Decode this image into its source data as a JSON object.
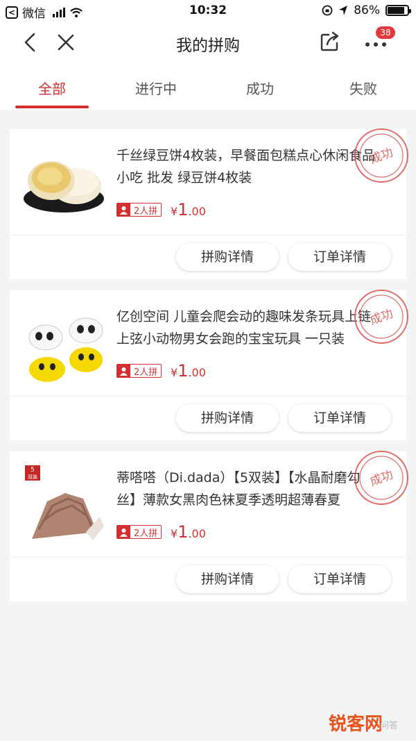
{
  "status_bar": {
    "carrier": "微信",
    "time": "10:32",
    "battery": "86%"
  },
  "nav": {
    "title": "我的拼购",
    "badge": "38"
  },
  "tabs": [
    {
      "label": "全部",
      "active": true
    },
    {
      "label": "进行中",
      "active": false
    },
    {
      "label": "成功",
      "active": false
    },
    {
      "label": "失败",
      "active": false
    }
  ],
  "orders": [
    {
      "title": "千丝绿豆饼4枚装，早餐面包糕点心休闲食品小吃 批发 绿豆饼4枚装",
      "group_tag": "2人拼",
      "price_symbol": "¥",
      "price_int": "1",
      "price_dec": ".00",
      "stamp": "成功",
      "btn_group": "拼购详情",
      "btn_order": "订单详情"
    },
    {
      "title": "亿创空间 儿童会爬会动的趣味发条玩具上链上弦小动物男女会跑的宝宝玩具 一只装",
      "group_tag": "2人拼",
      "price_symbol": "¥",
      "price_int": "1",
      "price_dec": ".00",
      "stamp": "成功",
      "btn_group": "拼购详情",
      "btn_order": "订单详情"
    },
    {
      "title": "蒂嗒嗒（Di.dada）【5双装】【水晶耐磨勾丝】薄款女黑肉色袜夏季透明超薄春夏",
      "group_tag": "2人拼",
      "price_symbol": "¥",
      "price_int": "1",
      "price_dec": ".00",
      "stamp": "成功",
      "btn_group": "拼购详情",
      "btn_order": "订单详情",
      "thumb_label_top": "5",
      "thumb_label_bottom": "双装"
    }
  ],
  "watermark": {
    "text": "锐客网",
    "sub": "问答"
  },
  "colors": {
    "accent": "#d32f2f",
    "badge": "#e4393c"
  }
}
